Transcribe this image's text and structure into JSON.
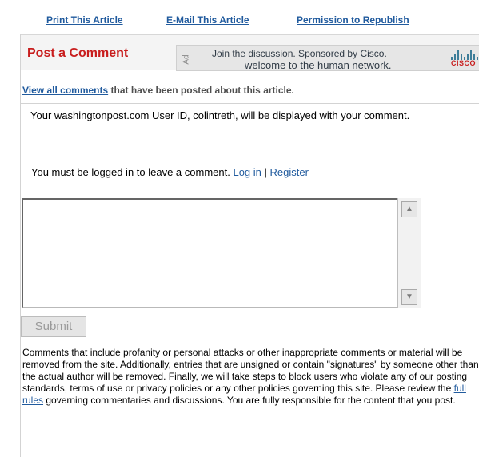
{
  "top_links": {
    "print": "Print This Article",
    "email": "E-Mail This Article",
    "permission": "Permission to Republish"
  },
  "comment": {
    "title": "Post a Comment",
    "view_all_link": "View all comments",
    "view_all_suffix": "that have been posted about this article.",
    "userid_text": "Your washingtonpost.com User ID, colintreth, will be displayed with your comment.",
    "login_prefix": "You must be logged in to leave a comment.",
    "login_link": "Log in",
    "separator": "|",
    "register_link": "Register",
    "submit_label": "Submit"
  },
  "ad": {
    "label": "Ad",
    "line1": "Join the discussion. Sponsored by Cisco.",
    "line2": "welcome to the human network.",
    "brand": "CISCO"
  },
  "rules": {
    "text_before_link": "Comments that include profanity or personal attacks or other inappropriate comments or material will be removed from the site. Additionally, entries that are unsigned or contain \"signatures\" by someone other than the actual author will be removed. Finally, we will take steps to block users who violate any of our posting standards, terms of use or privacy policies or any other policies governing this site. Please review the",
    "link": "full rules",
    "text_after_link": "governing commentaries and discussions. You are fully responsible for the content that you post."
  },
  "colors": {
    "link": "#215b9e",
    "title_red": "#c81d1d"
  }
}
